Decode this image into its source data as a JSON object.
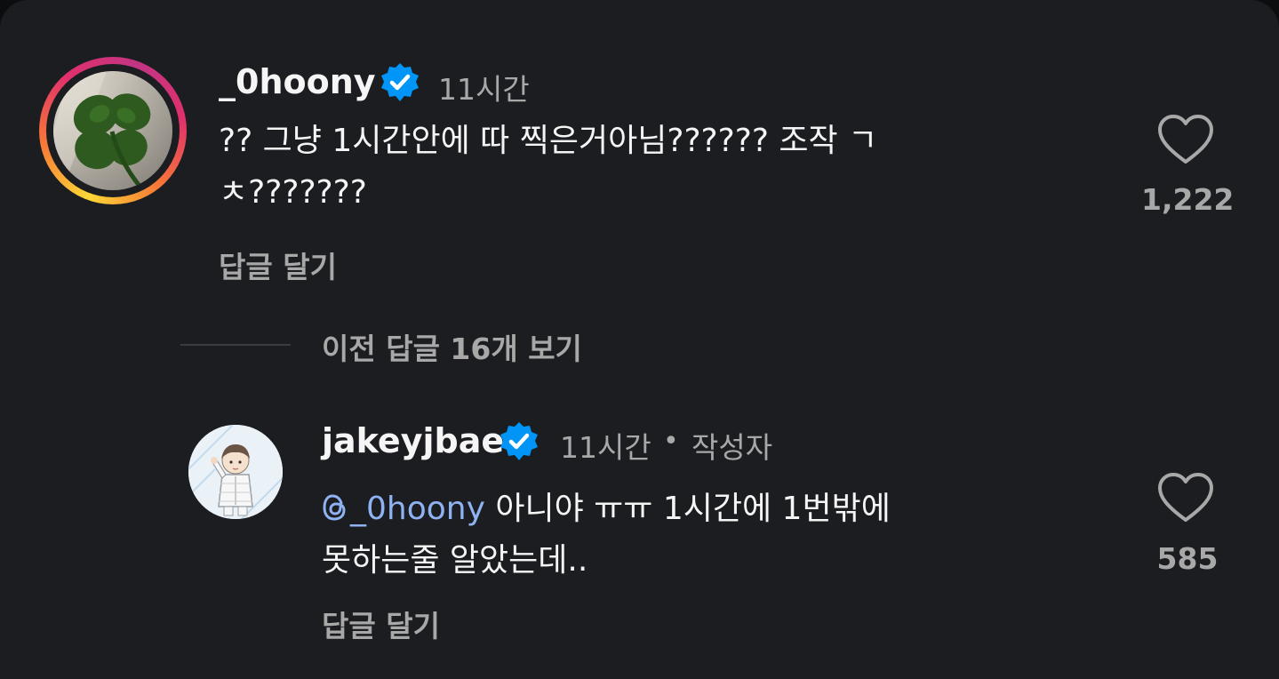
{
  "comments": [
    {
      "username": "_0hoony",
      "verified": true,
      "time": "11시간",
      "text_line1": "?? 그냥 1시간안에 따 찍은거아님?????? 조작 ㄱ",
      "text_line2": "ㅊ???????",
      "reply_label": "답글 달기",
      "likes": "1,222",
      "avatar": "clover-photo",
      "story_ring": true
    }
  ],
  "thread": {
    "view_more_label": "이전 답글 16개 보기"
  },
  "replies": [
    {
      "username": "jakeyjbae",
      "verified": true,
      "time": "11시간",
      "separator": "•",
      "author_badge": "작성자",
      "mention_icon": "threads-icon",
      "mention": "_0hoony",
      "text_line1_rest": " 아니야 ㅠㅠ 1시간에 1번밖에",
      "text_line2": "못하는줄 알았는데..",
      "reply_label": "답글 달기",
      "likes": "585",
      "avatar": "illustrated-boy-in-pajamas"
    }
  ],
  "icons": {
    "like": "heart-outline-icon",
    "verified": "verified-badge-icon"
  },
  "colors": {
    "background": "#1b1d21",
    "text_primary": "#f5f5f5",
    "text_secondary": "#a8a8a8",
    "verified_blue": "#0095f6",
    "mention_blue": "#8fb2f2"
  }
}
